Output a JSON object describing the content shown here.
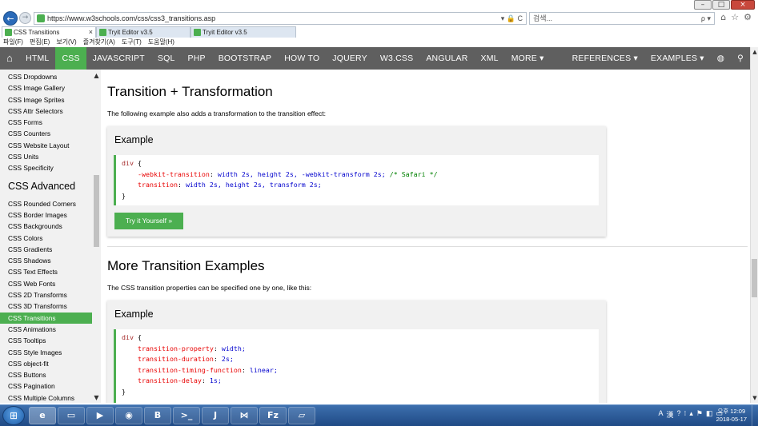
{
  "browser": {
    "window_buttons": {
      "minimize": "–",
      "maximize": "□",
      "close": "×"
    },
    "back_glyph": "←",
    "forward_glyph": "→",
    "url": "https://www.w3schools.com/css/css3_transitions.asp",
    "url_controls": "▾ 🔒 C",
    "search_placeholder": "검색...",
    "search_controls": "ρ ▾",
    "tool_icons": [
      "⌂",
      "☆",
      "⚙"
    ],
    "tabs": [
      {
        "label": "CSS Transitions",
        "close": "×"
      },
      {
        "label": "Tryit Editor v3.5",
        "close": ""
      },
      {
        "label": "Tryit Editor v3.5",
        "close": ""
      }
    ],
    "menu": [
      "파일(F)",
      "편집(E)",
      "보기(V)",
      "즐겨찾기(A)",
      "도구(T)",
      "도움말(H)"
    ]
  },
  "nav": {
    "home_icon": "⌂",
    "items": [
      "HTML",
      "CSS",
      "JAVASCRIPT",
      "SQL",
      "PHP",
      "BOOTSTRAP",
      "HOW TO",
      "JQUERY",
      "W3.CSS",
      "ANGULAR",
      "XML",
      "MORE ▾"
    ],
    "right_items": [
      "REFERENCES ▾",
      "EXAMPLES ▾",
      "◍",
      "⚲"
    ]
  },
  "sidebar": {
    "group1": [
      "CSS Dropdowns",
      "CSS Image Gallery",
      "CSS Image Sprites",
      "CSS Attr Selectors",
      "CSS Forms",
      "CSS Counters",
      "CSS Website Layout",
      "CSS Units",
      "CSS Specificity"
    ],
    "advanced_header": "CSS Advanced",
    "group2": [
      "CSS Rounded Corners",
      "CSS Border Images",
      "CSS Backgrounds",
      "CSS Colors",
      "CSS Gradients",
      "CSS Shadows",
      "CSS Text Effects",
      "CSS Web Fonts",
      "CSS 2D Transforms",
      "CSS 3D Transforms",
      "CSS Transitions",
      "CSS Animations",
      "CSS Tooltips",
      "CSS Style Images",
      "CSS object-fit",
      "CSS Buttons",
      "CSS Pagination",
      "CSS Multiple Columns"
    ],
    "active_item": "CSS Transitions",
    "scroll_up": "▲",
    "scroll_down": "▼"
  },
  "content": {
    "section1": {
      "title": "Transition + Transformation",
      "intro": "The following example also adds a transformation to the transition effect:",
      "example_heading": "Example",
      "code": {
        "selector": "div",
        "open": " {",
        "line1_prop": "-webkit-transition",
        "line1_val": "width 2s, height 2s, -webkit-transform 2s;",
        "line1_comment": "/* Safari */",
        "line2_prop": "transition",
        "line2_val": "width 2s, height 2s, transform 2s;",
        "close": "}"
      },
      "button": "Try it Yourself »"
    },
    "section2": {
      "title": "More Transition Examples",
      "intro": "The CSS transition properties can be specified one by one, like this:",
      "example_heading": "Example",
      "code": {
        "selector": "div",
        "open": " {",
        "lines": [
          {
            "prop": "transition-property",
            "val": "width;"
          },
          {
            "prop": "transition-duration",
            "val": "2s;"
          },
          {
            "prop": "transition-timing-function",
            "val": "linear;"
          },
          {
            "prop": "transition-delay",
            "val": "1s;"
          }
        ],
        "close": "}"
      }
    }
  },
  "taskbar": {
    "start_glyph": "⊞",
    "apps": [
      "e",
      "▭",
      "▶",
      "◉",
      "B",
      ">_",
      "J",
      "⋈",
      "Fz",
      "▱"
    ],
    "tray_items": [
      "A",
      "漢",
      "?",
      "⁝",
      "▴",
      "⚑",
      "◧",
      "▭"
    ],
    "time": "오후 12:09",
    "date": "2018-05-17"
  },
  "scroll": {
    "up": "▲",
    "down": "▼"
  },
  "colors": {
    "accent": "#4caf50",
    "nav_bg": "#5f5f5f",
    "sidebar_bg": "#f1f1f1",
    "taskbar": "#2a5a98"
  }
}
